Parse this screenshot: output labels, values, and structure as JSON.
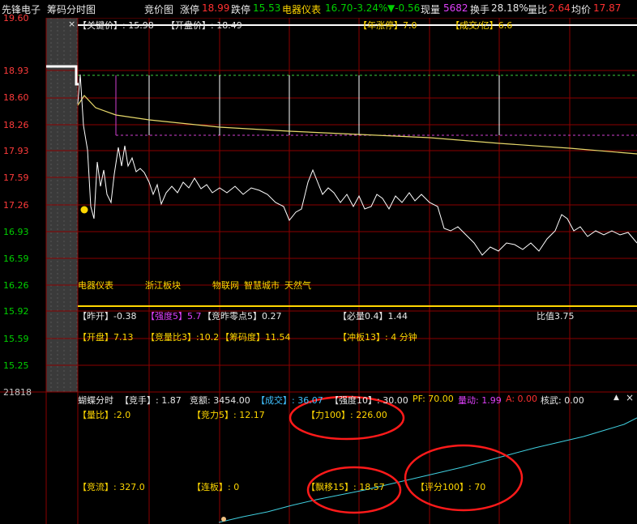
{
  "header": {
    "stock_name": "先锋电子",
    "tab_timeshare": "筹码分时图",
    "tab_auction": "竞价图",
    "limit_up_label": "涨停",
    "limit_up_value": "18.99",
    "limit_down_label": "跌停",
    "limit_down_value": "15.53",
    "sector_name": "电器仪表",
    "sector_price": "16.70",
    "sector_pct": "-3.24%",
    "sector_change": "▼-0.56",
    "volume_label": "现量",
    "volume_value": "5682",
    "turnover_label": "换手",
    "turnover_value": "28.18%",
    "vol_ratio_label": "量比",
    "vol_ratio_value": "2.64",
    "avg_price_label": "均价",
    "avg_price_value": "17.87"
  },
  "y_axis": {
    "prices": [
      "19.60",
      "18.93",
      "18.60",
      "18.26",
      "17.93",
      "17.59",
      "17.26",
      "16.93",
      "16.59",
      "16.26",
      "15.92",
      "15.59",
      "15.25"
    ],
    "bottom_label": "21818"
  },
  "top_tags": {
    "close_mark": "×",
    "key_price": "【关键价】: 15.98",
    "open_price": "【开盘价】: 18.49",
    "limit_up_years": "【年涨停】7.0",
    "turnover_billion": "【成交/亿】6.6"
  },
  "concepts": [
    "电器仪表",
    "浙江板块",
    "物联网",
    "智慧城市",
    "天然气"
  ],
  "info_rows": {
    "yesterday_open": "【昨开】-0.38",
    "strength": "【强度5】5.7",
    "yesterday_zero": "【竞昨零点5】0.27",
    "must_rise": "【必量0.4】1.44",
    "ratio": "比值3.75",
    "open": "【开盘】7.13",
    "auction_vol_ratio": "【竞量比3】:10.2",
    "chip_degree": "【筹码度】11.54",
    "limit_time": "【冲板13】: 4 分钟"
  },
  "lower_panel": {
    "title": "蝴蝶分时",
    "auction_hand": "【竞手】: 1.87",
    "auction_amount": "竞额: 3454.00",
    "deal": "【成交】: 36.07",
    "strength10": "【强度10】: 30.00",
    "pf": "PF: 70.00",
    "vol_move": "量动: 1.99",
    "a_value": "A: 0.00",
    "hewu": "核武: 0.00",
    "vol_ratio2": "【量比】:2.0",
    "auction_power": "【竞力5】: 12.17",
    "power100": "【力100】: 226.00",
    "auction_flow": "【竞流】: 327.0",
    "consecutive": "【连板】: 0",
    "drift": "【飘移15】: 18.57",
    "score100": "【评分100】: 70"
  },
  "colors": {
    "grid": "#8b0000",
    "price_line": "#ffffff",
    "avg_line": "#e6d86a",
    "accent_yellow": "#ffd700",
    "up_red": "#ff3030",
    "down_green": "#00d000",
    "cyan_line": "#40d0e0",
    "circle": "#ff1a1a"
  }
}
